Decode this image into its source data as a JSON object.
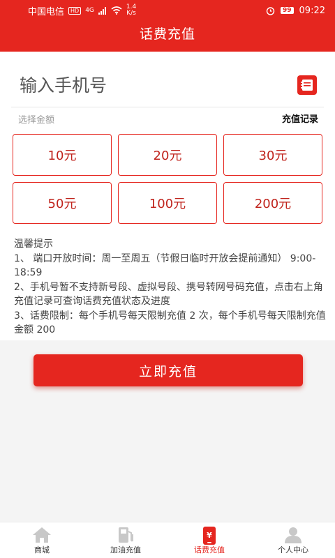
{
  "status_bar": {
    "carrier": "中国电信",
    "hd": "HD",
    "signal_type": "4G",
    "speed_value": "1.4",
    "speed_unit": "K/s",
    "battery": "99",
    "time": "09:22"
  },
  "header": {
    "title": "话费充值"
  },
  "phone": {
    "placeholder": "输入手机号",
    "value": ""
  },
  "amount_section": {
    "label": "选择金额",
    "record_link": "充值记录",
    "options": [
      "10元",
      "20元",
      "30元",
      "50元",
      "100元",
      "200元"
    ]
  },
  "tips": {
    "title": "温馨提示",
    "lines": [
      "1、 端口开放时间：周一至周五（节假日临时开放会提前通知） 9:00-18:59",
      "2、手机号暂不支持新号段、虚拟号段、携号转网号码充值，点击右上角充值记录可查询话费充值状态及进度",
      "3、话费限制：每个手机号每天限制充值 2 次，每个手机号每天限制充值金额 200"
    ]
  },
  "submit": {
    "label": "立即充值"
  },
  "tabbar": {
    "items": [
      {
        "label": "商城",
        "icon": "home-icon",
        "active": false
      },
      {
        "label": "加油充值",
        "icon": "fuel-pump-icon",
        "active": false
      },
      {
        "label": "话费充值",
        "icon": "phone-recharge-icon",
        "active": true
      },
      {
        "label": "个人中心",
        "icon": "user-icon",
        "active": false
      }
    ]
  },
  "colors": {
    "brand": "#e5261f",
    "amount_text": "#c0241d",
    "inactive_icon": "#c8c8c8"
  }
}
